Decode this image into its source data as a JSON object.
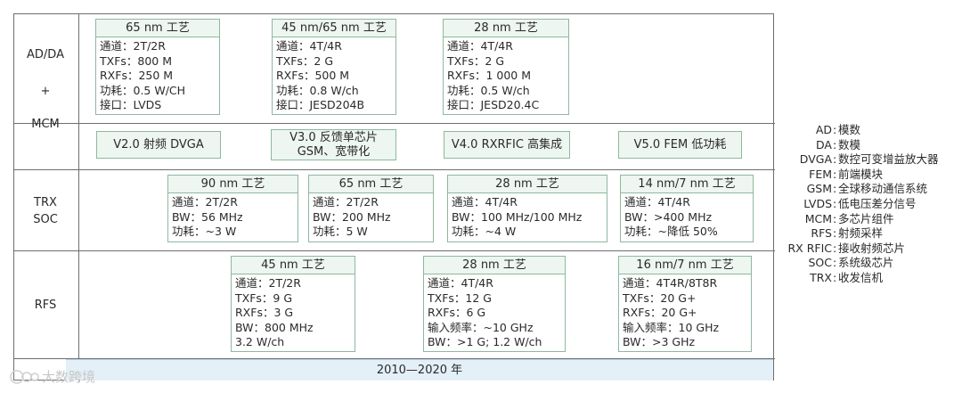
{
  "rows": {
    "adda": {
      "line1": "AD/DA",
      "line2": "+",
      "line3": "MCM"
    },
    "trx": {
      "line1": "TRX",
      "line2": "SOC"
    },
    "rfs": {
      "line1": "RFS"
    }
  },
  "adda_cards": [
    {
      "title": "65 nm 工艺",
      "lines": [
        "通道：2T/2R",
        "TXFs：800 M",
        "RXFs：250 M",
        "功耗：0.5 W/CH",
        "接口：LVDS"
      ]
    },
    {
      "title": "45 nm/65 nm 工艺",
      "lines": [
        "通道：4T/4R",
        "TXFs：2 G",
        "RXFs：500 M",
        "功耗：0.8 W/ch",
        "接口：JESD204B"
      ]
    },
    {
      "title": "28 nm 工艺",
      "lines": [
        "通道：4T/4R",
        "TXFs：2 G",
        "RXFs：1 000 M",
        "功耗：0.5 W/ch",
        "接口：JESD20.4C"
      ]
    }
  ],
  "versions": [
    {
      "line1": "V2.0 射频 DVGA",
      "line2": ""
    },
    {
      "line1": "V3.0 反馈单芯片",
      "line2": "GSM、宽带化"
    },
    {
      "line1": "V4.0 RXRFIC 高集成",
      "line2": ""
    },
    {
      "line1": "V5.0 FEM 低功耗",
      "line2": ""
    }
  ],
  "trx_cards": [
    {
      "title": "90 nm 工艺",
      "lines": [
        "通道：2T/2R",
        "BW：56 MHz",
        "功耗：~3 W"
      ]
    },
    {
      "title": "65 nm 工艺",
      "lines": [
        "通道：2T/2R",
        "BW：200 MHz",
        "功耗：5 W"
      ]
    },
    {
      "title": "28 nm 工艺",
      "lines": [
        "通道：4T/4R",
        "BW：100 MHz/100 MHz",
        "功耗：~4 W"
      ]
    },
    {
      "title": "14 nm/7 nm 工艺",
      "lines": [
        "通道：4T/4R",
        "BW：>400 MHz",
        "功耗：~降低 50%"
      ]
    }
  ],
  "rfs_cards": [
    {
      "title": "45 nm 工艺",
      "lines": [
        "通道：2T/2R",
        "TXFs：9 G",
        "RXFs：3 G",
        "BW：800 MHz",
        "3.2 W/ch"
      ]
    },
    {
      "title": "28 nm 工艺",
      "lines": [
        "通道：4T/4R",
        "TXFs：12 G",
        "RXFs：6 G",
        "输入频率：~10 GHz",
        "BW：>1 G; 1.2 W/ch"
      ]
    },
    {
      "title": "16 nm/7 nm 工艺",
      "lines": [
        "通道：4T4R/8T8R",
        "TXFs：20 G+",
        "RXFs：20 G+",
        "输入频率：10 GHz",
        "BW：>3 GHz"
      ]
    }
  ],
  "timeline": "2010—2020 年",
  "legend": [
    {
      "abbr": "AD",
      "text": "模数"
    },
    {
      "abbr": "DA",
      "text": "数模"
    },
    {
      "abbr": "DVGA",
      "text": "数控可变增益放大器"
    },
    {
      "abbr": "FEM",
      "text": "前端模块"
    },
    {
      "abbr": "GSM",
      "text": "全球移动通信系统"
    },
    {
      "abbr": "LVDS",
      "text": "低电压差分信号"
    },
    {
      "abbr": "MCM",
      "text": "多芯片组件"
    },
    {
      "abbr": "RFS",
      "text": "射频采样"
    },
    {
      "abbr": "RX RFIC",
      "text": "接收射频芯片"
    },
    {
      "abbr": "SOC",
      "text": "系统级芯片"
    },
    {
      "abbr": "TRX",
      "text": "收发信机"
    }
  ],
  "watermark": "大数跨境",
  "colors": {
    "border": "#6e6e6e",
    "card_border": "#8fb89f",
    "card_title_bg": "#edf6f0",
    "timeline_bg": "#e4f0f7"
  }
}
